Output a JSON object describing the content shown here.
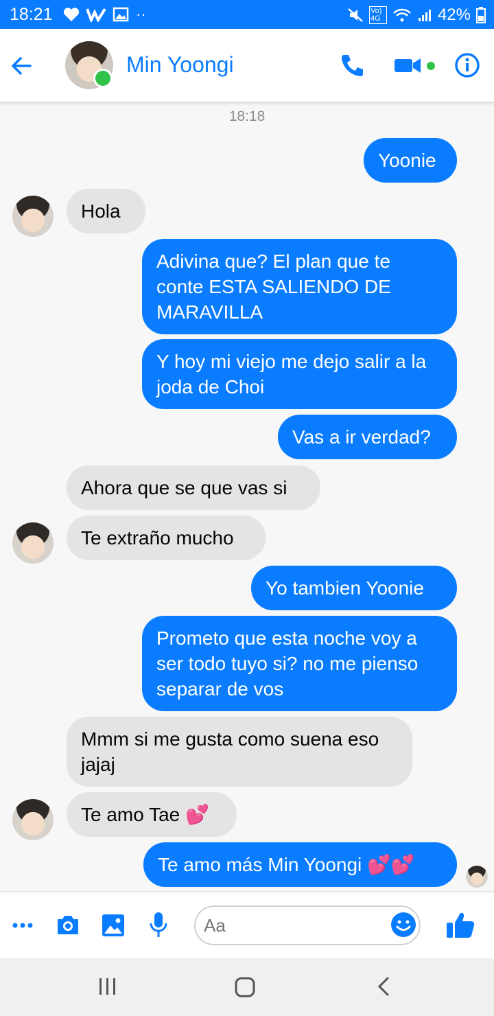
{
  "status": {
    "time": "18:21",
    "battery": "42%",
    "network": "Vo) 4G"
  },
  "header": {
    "name": "Min Yoongi",
    "accent": "#0a7cff"
  },
  "conversation": {
    "timestamp": "18:18",
    "messages": [
      {
        "dir": "out",
        "text": "Yoonie"
      },
      {
        "dir": "in",
        "text": "Hola"
      },
      {
        "dir": "out",
        "text": "Adivina que? El plan que te conte ESTA SALIENDO DE MARAVILLA"
      },
      {
        "dir": "out",
        "text": "Y hoy mi viejo me dejo salir a la joda de Choi"
      },
      {
        "dir": "out",
        "text": "Vas a ir verdad?"
      },
      {
        "dir": "in",
        "text": "Ahora que se que vas si"
      },
      {
        "dir": "in",
        "text": "Te extraño mucho"
      },
      {
        "dir": "out",
        "text": "Yo tambien Yoonie"
      },
      {
        "dir": "out",
        "text": "Prometo que esta noche voy a ser todo tuyo si? no me pienso separar de vos"
      },
      {
        "dir": "in",
        "text": "Mmm si me gusta como suena eso jajaj"
      },
      {
        "dir": "in",
        "text": "Te amo Tae 💕"
      },
      {
        "dir": "out",
        "text": "Te amo más Min Yoongi 💕💕"
      }
    ]
  },
  "composer": {
    "placeholder": "Aa",
    "icons": [
      "more-icon",
      "camera-icon",
      "gallery-icon",
      "microphone-icon",
      "emoji-icon",
      "thumbs-up-icon"
    ]
  },
  "colors": {
    "outgoing_bubble": "#0a7cff",
    "incoming_bubble": "#e4e4e4",
    "online": "#31c24a"
  }
}
